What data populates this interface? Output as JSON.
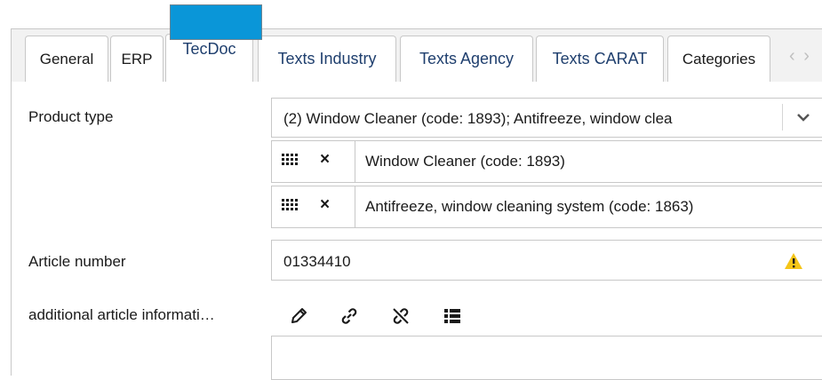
{
  "tabs": [
    {
      "label": "General"
    },
    {
      "label": "ERP"
    },
    {
      "label": "TecDoc"
    },
    {
      "label": "Texts Industry"
    },
    {
      "label": "Texts Agency"
    },
    {
      "label": "Texts CARAT"
    },
    {
      "label": "Categories"
    }
  ],
  "tab_scroll": {
    "arrows": "‹ ›"
  },
  "product_type": {
    "label": "Product type",
    "selected": "(2) Window Cleaner (code: 1893); Antifreeze, window clea",
    "items": [
      {
        "text": "Window Cleaner (code: 1893)"
      },
      {
        "text": "Antifreeze, window cleaning system (code: 1863)"
      }
    ]
  },
  "article_number": {
    "label": "Article number",
    "value": "01334410"
  },
  "additional_info": {
    "label": "additional article informati…"
  },
  "icons": {
    "remove": "×",
    "pencil": "pencil-icon",
    "link": "link-icon",
    "unlink": "unlink-icon",
    "list": "list-icon",
    "warning": "warning-icon",
    "drag": "grid-icon"
  },
  "colors": {
    "accent": "#0a96d8",
    "tab_active_text": "#1f3f6e",
    "warning": "#f5c518",
    "border": "#c8c8c8"
  }
}
